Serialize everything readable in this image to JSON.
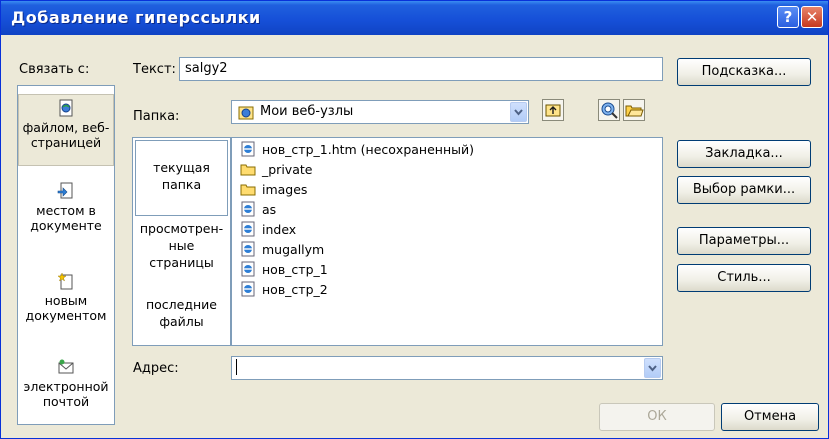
{
  "title": "Добавление гиперссылки",
  "link_to_label": "Связать с:",
  "text_label": "Текст:",
  "text_value": "salgy2",
  "screentip_button": "Подсказка...",
  "folder_label": "Папка:",
  "folder_value": "Мои веб-узлы",
  "side_items": [
    {
      "label": "файлом, веб-\nстраницей",
      "icon": "web-page-icon"
    },
    {
      "label": "местом в\nдокументе",
      "icon": "place-in-document-icon"
    },
    {
      "label": "новым\nдокументом",
      "icon": "new-document-icon"
    },
    {
      "label": "электронной\nпочтой",
      "icon": "email-icon"
    }
  ],
  "browse_items": [
    {
      "label": "текущая\nпапка"
    },
    {
      "label": "просмотрен-\nные\nстраницы"
    },
    {
      "label": "последние\nфайлы"
    }
  ],
  "files": [
    {
      "name": "нов_стр_1.htm (несохраненный)",
      "icon": "ie-page-icon"
    },
    {
      "name": "_private",
      "icon": "folder-icon"
    },
    {
      "name": "images",
      "icon": "folder-icon"
    },
    {
      "name": "as",
      "icon": "ie-page-icon"
    },
    {
      "name": "index",
      "icon": "ie-page-icon"
    },
    {
      "name": "mugallym",
      "icon": "ie-page-icon"
    },
    {
      "name": "нов_стр_1",
      "icon": "ie-page-icon"
    },
    {
      "name": "нов_стр_2",
      "icon": "ie-page-icon"
    }
  ],
  "right_buttons": {
    "bookmark": "Закладка...",
    "frame": "Выбор рамки...",
    "params": "Параметры...",
    "style": "Стиль..."
  },
  "address_label": "Адрес:",
  "address_value": "",
  "ok": "ОК",
  "cancel": "Отмена",
  "colors": {
    "titlebar": "#1650d8",
    "dialog_bg": "#ece9d8",
    "border": "#7f9db9"
  }
}
